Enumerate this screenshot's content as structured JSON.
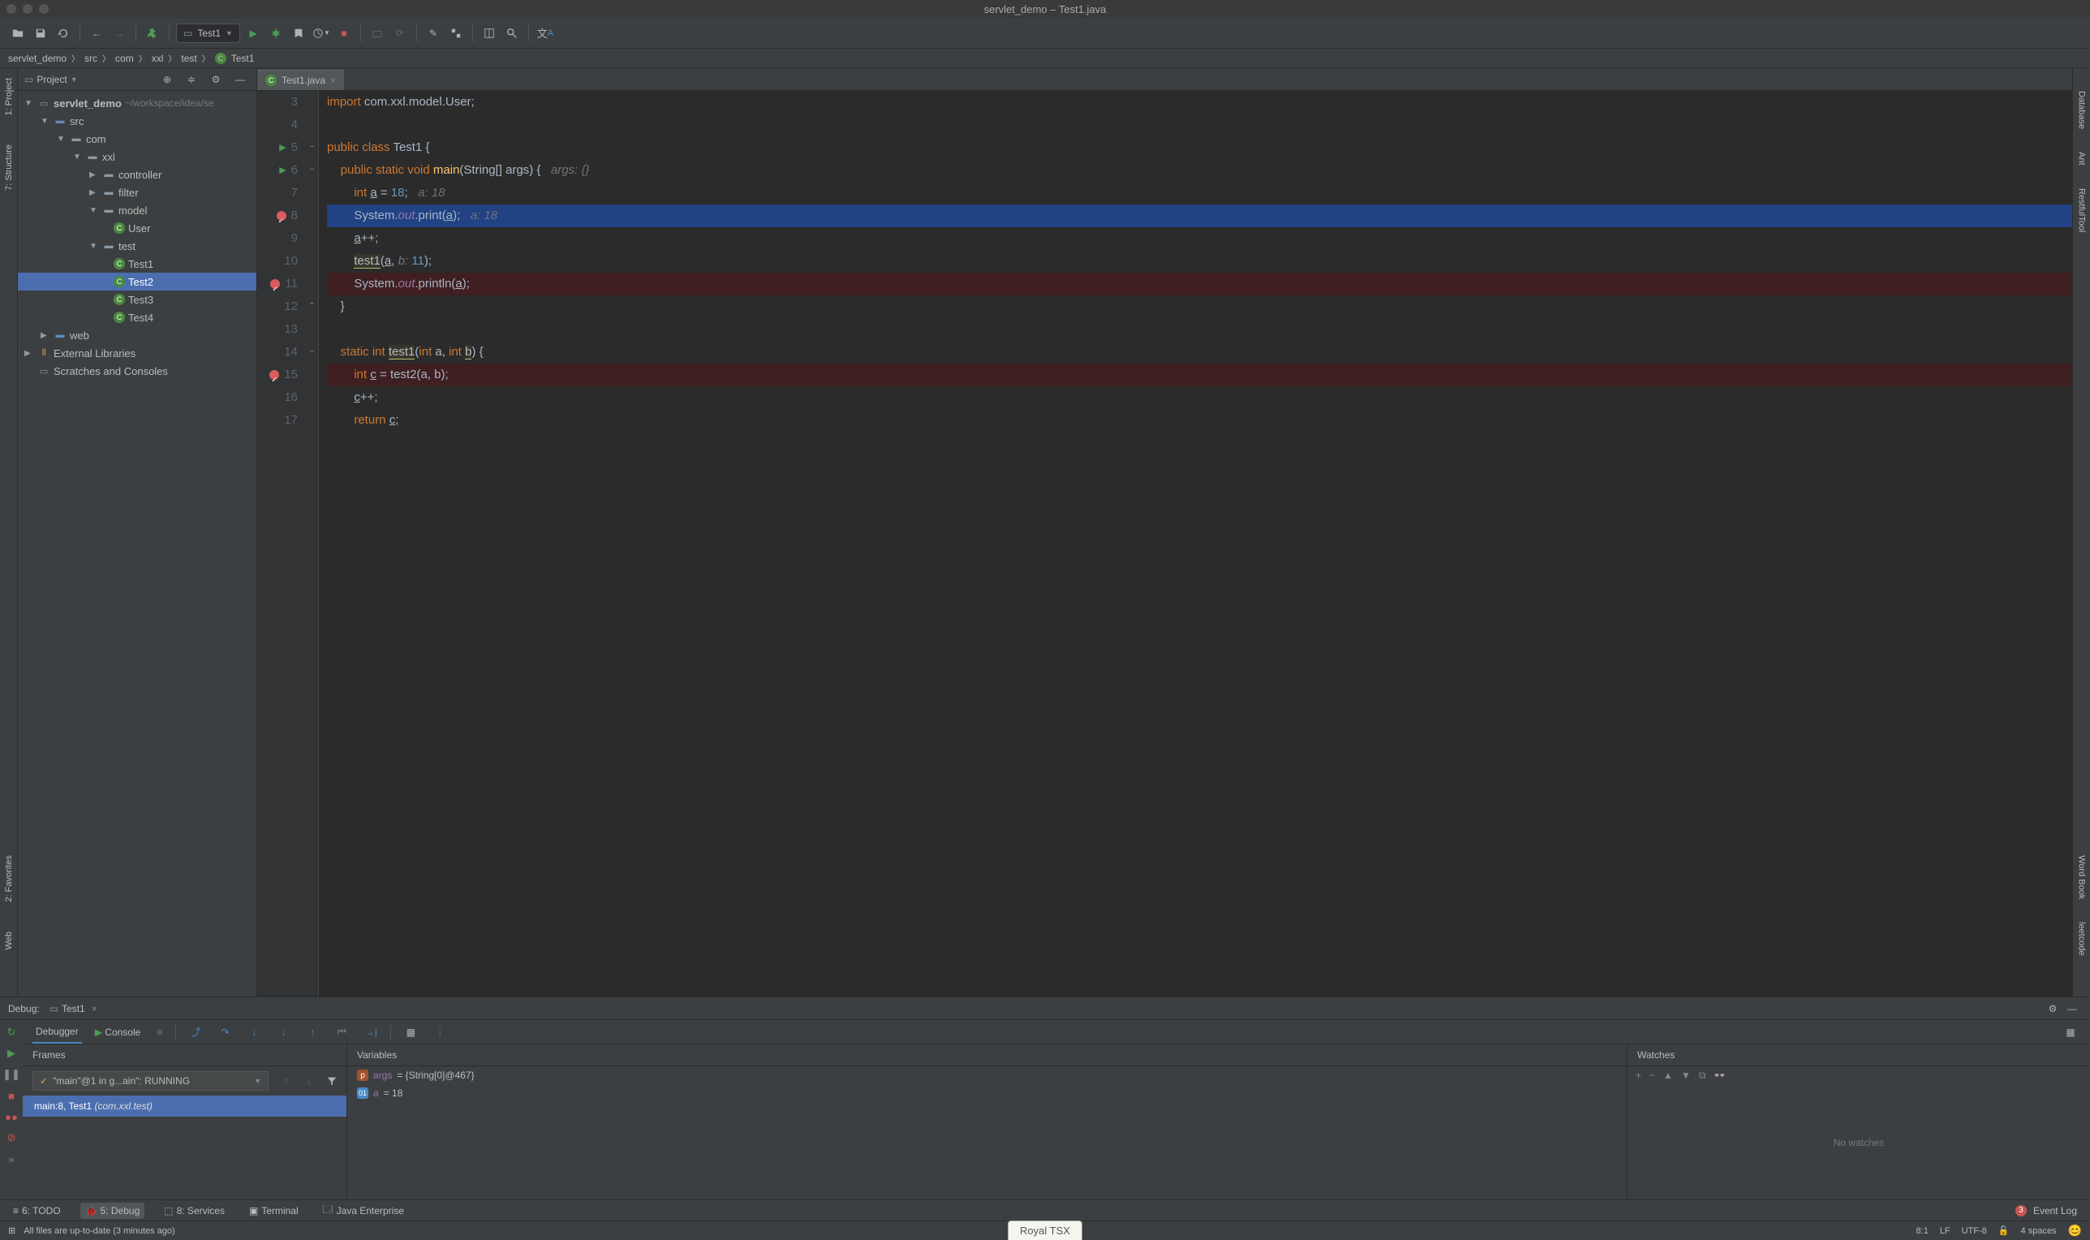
{
  "window": {
    "title": "servlet_demo – Test1.java"
  },
  "run_config": {
    "name": "Test1"
  },
  "breadcrumb": [
    "servlet_demo",
    "src",
    "com",
    "xxl",
    "test",
    "Test1"
  ],
  "project_panel": {
    "title": "Project",
    "root": {
      "name": "servlet_demo",
      "path": "~/workspace/idea/se"
    },
    "tree": {
      "src": "src",
      "com": "com",
      "xxl": "xxl",
      "controller": "controller",
      "filter": "filter",
      "model": "model",
      "user": "User",
      "test": "test",
      "test1": "Test1",
      "test2": "Test2",
      "test3": "Test3",
      "test4": "Test4",
      "web": "web",
      "extlib": "External Libraries",
      "scratches": "Scratches and Consoles"
    }
  },
  "editor": {
    "tab": "Test1.java",
    "lines": [
      {
        "n": 3,
        "html": "<span class='kw'>import</span> <span class='id'>com.xxl.model.User;</span>"
      },
      {
        "n": 4,
        "html": ""
      },
      {
        "n": 5,
        "html": "<span class='kw'>public class</span> <span class='id'>Test1 {</span>",
        "run": true,
        "fold": "−"
      },
      {
        "n": 6,
        "html": "    <span class='kw'>public static void</span> <span class='method-name'>main</span><span class='id'>(String[] args) {</span>   <span class='hint'>args: {}</span>",
        "run": true,
        "fold": "−"
      },
      {
        "n": 7,
        "html": "        <span class='kw'>int</span> <span class='id'><u>a</u> = </span><span class='num'>18</span><span class='id'>;</span>   <span class='hint'>a: 18</span>"
      },
      {
        "n": 8,
        "html": "        <span class='id'>System.</span><span class='field'>out</span><span class='id'>.print(<u>a</u>);</span>   <span class='hint'>a: 18</span>",
        "current": true,
        "bp": true
      },
      {
        "n": 9,
        "html": "        <span class='id'><u>a</u>++;</span>"
      },
      {
        "n": 10,
        "html": "        <span class='underline-warn'>test1</span><span class='id'>(<u>a</u>, </span><span class='hint'>b: </span><span class='num'>11</span><span class='id'>);</span>"
      },
      {
        "n": 11,
        "html": "        <span class='id'>System.</span><span class='field'>out</span><span class='id'>.println(<u>a</u>);</span>",
        "bp": true,
        "bpline": true
      },
      {
        "n": 12,
        "html": "    <span class='id'>}</span>",
        "fold": "⌃"
      },
      {
        "n": 13,
        "html": ""
      },
      {
        "n": 14,
        "html": "    <span class='kw'>static int</span> <span class='underline-warn'>test1</span><span class='id'>(</span><span class='kw'>int</span> <span class='id'>a, </span><span class='kw'>int</span> <span class='underline-warn'>b</span><span class='id'>) {</span>",
        "fold": "−"
      },
      {
        "n": 15,
        "html": "        <span class='kw'>int</span> <span class='id'><u>c</u> = </span><span class='id'>test2(a, b);</span>",
        "bp": true,
        "bpline": true
      },
      {
        "n": 16,
        "html": "        <span class='id'><u>c</u>++;</span>"
      },
      {
        "n": 17,
        "html": "        <span class='kw'>return</span> <span class='id'><u>c</u>;</span>"
      }
    ]
  },
  "debug": {
    "title": "Debug:",
    "config": "Test1",
    "tabs": {
      "debugger": "Debugger",
      "console": "Console"
    },
    "frames": {
      "title": "Frames",
      "thread": "\"main\"@1 in g...ain\": RUNNING",
      "frame_main": "main:8, Test1",
      "frame_pkg": "(com.xxl.test)"
    },
    "variables": {
      "title": "Variables",
      "args": {
        "name": "args",
        "val": "= {String[0]@467}"
      },
      "a": {
        "name": "a",
        "val": "= 18"
      }
    },
    "watches": {
      "title": "Watches",
      "empty": "No watches"
    }
  },
  "left_rail": {
    "project": "1: Project",
    "structure": "7: Structure",
    "favorites": "2: Favorites",
    "web": "Web"
  },
  "right_rail": {
    "database": "Database",
    "ant": "Ant",
    "restfultool": "RestfulTool",
    "wordbook": "Word Book",
    "leetcode": "leetcode"
  },
  "bottom_tabs": {
    "todo": "6: TODO",
    "debug": "5: Debug",
    "services": "8: Services",
    "terminal": "Terminal",
    "javaee": "Java Enterprise",
    "eventlog": "Event Log",
    "event_count": "3"
  },
  "status": {
    "msg": "All files are up-to-date (3 minutes ago)",
    "popup": "Royal TSX",
    "pos": "8:1",
    "eol": "LF",
    "enc": "UTF-8",
    "indent": "4 spaces"
  }
}
